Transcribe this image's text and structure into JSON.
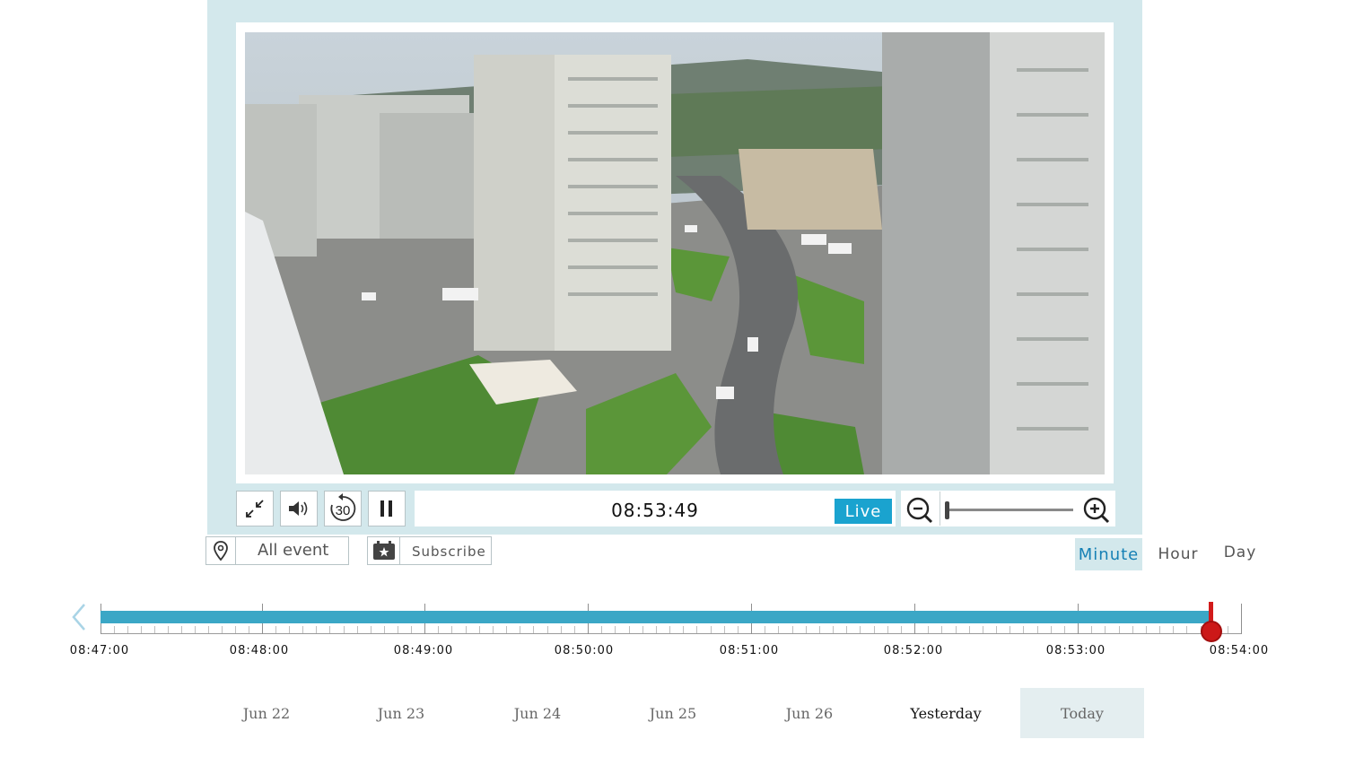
{
  "player": {
    "current_time": "08:53:49",
    "live_label": "Live",
    "rewind_seconds": "30",
    "zoom_level": 0.0
  },
  "icons": {
    "collapse": "collapse-icon",
    "volume": "volume-icon",
    "rewind": "rewind-30-icon",
    "pause": "pause-icon",
    "zoom_out": "zoom-out-icon",
    "zoom_in": "zoom-in-icon",
    "location": "location-pin-icon",
    "subscribe": "calendar-star-icon",
    "prev": "chevron-left-icon"
  },
  "filters": {
    "event_label": "All event",
    "subscribe_label": "Subscribe"
  },
  "granularity": {
    "options": [
      "Minute",
      "Hour",
      "Day"
    ],
    "selected": "Minute"
  },
  "timeline": {
    "labels": [
      "08:47:00",
      "08:48:00",
      "08:49:00",
      "08:50:00",
      "08:51:00",
      "08:52:00",
      "08:53:00",
      "08:54:00"
    ],
    "cursor_time": "08:53:49"
  },
  "days": {
    "items": [
      "Jun 22",
      "Jun 23",
      "Jun 24",
      "Jun 25",
      "Jun 26",
      "Yesterday",
      "Today"
    ],
    "selected": "Today"
  },
  "colors": {
    "frame": "#d3e8ec",
    "accent": "#1aa3cf",
    "timeline_bar": "#3ba7c6",
    "cursor": "#d21b1b"
  }
}
